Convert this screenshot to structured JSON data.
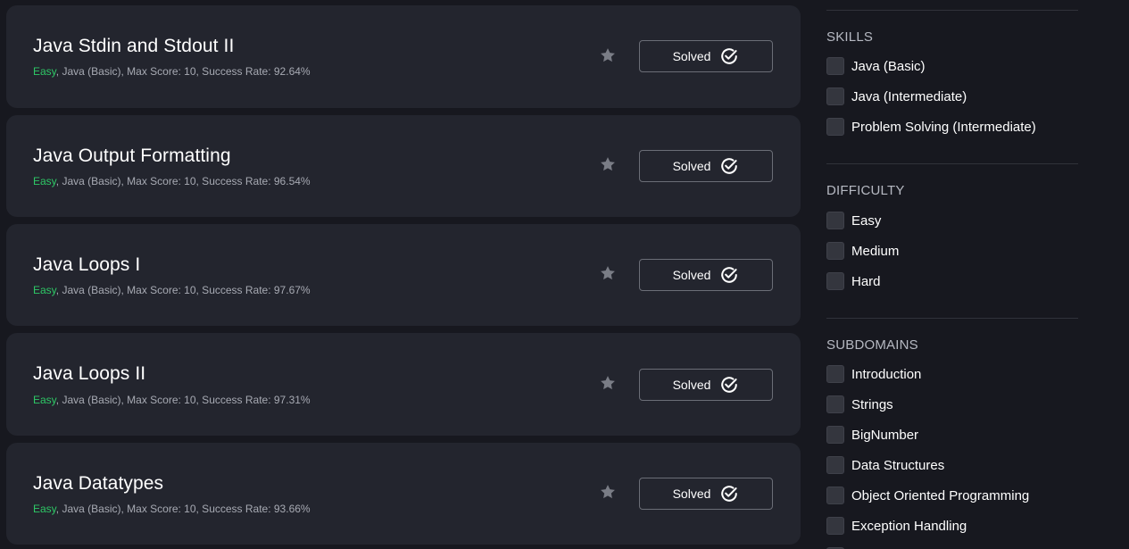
{
  "challenges": [
    {
      "title": "Java Stdin and Stdout II",
      "difficulty": "Easy",
      "meta": ", Java (Basic), Max Score: 10, Success Rate: 92.64%",
      "status": "Solved"
    },
    {
      "title": "Java Output Formatting",
      "difficulty": "Easy",
      "meta": ", Java (Basic), Max Score: 10, Success Rate: 96.54%",
      "status": "Solved"
    },
    {
      "title": "Java Loops I",
      "difficulty": "Easy",
      "meta": ", Java (Basic), Max Score: 10, Success Rate: 97.67%",
      "status": "Solved"
    },
    {
      "title": "Java Loops II",
      "difficulty": "Easy",
      "meta": ", Java (Basic), Max Score: 10, Success Rate: 97.31%",
      "status": "Solved"
    },
    {
      "title": "Java Datatypes",
      "difficulty": "Easy",
      "meta": ", Java (Basic), Max Score: 10, Success Rate: 93.66%",
      "status": "Solved"
    }
  ],
  "filters": {
    "skills": {
      "title": "SKILLS",
      "options": [
        "Java (Basic)",
        "Java (Intermediate)",
        "Problem Solving (Intermediate)"
      ]
    },
    "difficulty": {
      "title": "DIFFICULTY",
      "options": [
        "Easy",
        "Medium",
        "Hard"
      ]
    },
    "subdomains": {
      "title": "SUBDOMAINS",
      "options": [
        "Introduction",
        "Strings",
        "BigNumber",
        "Data Structures",
        "Object Oriented Programming",
        "Exception Handling"
      ]
    }
  },
  "colors": {
    "background": "#17181f",
    "card": "#23252e",
    "easy": "#2ec866",
    "muted_text": "#a7aab3",
    "star": "#7a7d86"
  },
  "icons": {
    "star": "star-icon",
    "solved": "check-circle-icon"
  }
}
